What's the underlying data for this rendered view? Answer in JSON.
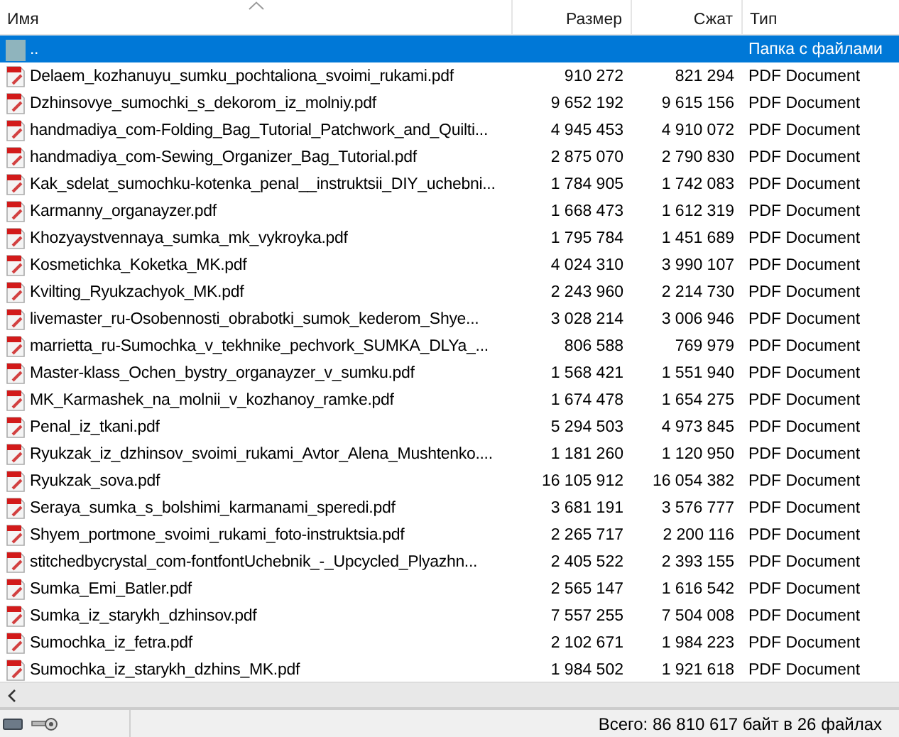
{
  "columns": [
    {
      "label": "Имя",
      "sorted": true
    },
    {
      "label": "Размер",
      "sorted": false
    },
    {
      "label": "Сжат",
      "sorted": false
    },
    {
      "label": "Тип",
      "sorted": false
    }
  ],
  "rows": [
    {
      "kind": "parent",
      "name": "..",
      "size": "",
      "packed": "",
      "type": "Папка с файлами",
      "selected": true
    },
    {
      "kind": "pdf",
      "name": "Delaem_kozhanuyu_sumku_pochtaliona_svoimi_rukami.pdf",
      "size": "910 272",
      "packed": "821 294",
      "type": "PDF Document",
      "selected": false
    },
    {
      "kind": "pdf",
      "name": "Dzhinsovye_sumochki_s_dekorom_iz_molniy.pdf",
      "size": "9 652 192",
      "packed": "9 615 156",
      "type": "PDF Document",
      "selected": false
    },
    {
      "kind": "pdf",
      "name": "handmadiya_com-Folding_Bag_Tutorial_Patchwork_and_Quilti...",
      "size": "4 945 453",
      "packed": "4 910 072",
      "type": "PDF Document",
      "selected": false
    },
    {
      "kind": "pdf",
      "name": "handmadiya_com-Sewing_Organizer_Bag_Tutorial.pdf",
      "size": "2 875 070",
      "packed": "2 790 830",
      "type": "PDF Document",
      "selected": false
    },
    {
      "kind": "pdf",
      "name": "Kak_sdelat_sumochku-kotenka_penal__instruktsii_DIY_uchebni...",
      "size": "1 784 905",
      "packed": "1 742 083",
      "type": "PDF Document",
      "selected": false
    },
    {
      "kind": "pdf",
      "name": "Karmanny_organayzer.pdf",
      "size": "1 668 473",
      "packed": "1 612 319",
      "type": "PDF Document",
      "selected": false
    },
    {
      "kind": "pdf",
      "name": "Khozyaystvennaya_sumka_mk_vykroyka.pdf",
      "size": "1 795 784",
      "packed": "1 451 689",
      "type": "PDF Document",
      "selected": false
    },
    {
      "kind": "pdf",
      "name": "Kosmetichka_Koketka_MK.pdf",
      "size": "4 024 310",
      "packed": "3 990 107",
      "type": "PDF Document",
      "selected": false
    },
    {
      "kind": "pdf",
      "name": "Kvilting_Ryukzachyok_MK.pdf",
      "size": "2 243 960",
      "packed": "2 214 730",
      "type": "PDF Document",
      "selected": false
    },
    {
      "kind": "pdf",
      "name": "livemaster_ru-Osobennosti_obrabotki_sumok_kederom_Shye...",
      "size": "3 028 214",
      "packed": "3 006 946",
      "type": "PDF Document",
      "selected": false
    },
    {
      "kind": "pdf",
      "name": "marrietta_ru-Sumochka_v_tekhnike_pechvork_SUMKA_DLYa_...",
      "size": "806 588",
      "packed": "769 979",
      "type": "PDF Document",
      "selected": false
    },
    {
      "kind": "pdf",
      "name": "Master-klass_Ochen_bystry_organayzer_v_sumku.pdf",
      "size": "1 568 421",
      "packed": "1 551 940",
      "type": "PDF Document",
      "selected": false
    },
    {
      "kind": "pdf",
      "name": "MK_Karmashek_na_molnii_v_kozhanoy_ramke.pdf",
      "size": "1 674 478",
      "packed": "1 654 275",
      "type": "PDF Document",
      "selected": false
    },
    {
      "kind": "pdf",
      "name": "Penal_iz_tkani.pdf",
      "size": "5 294 503",
      "packed": "4 973 845",
      "type": "PDF Document",
      "selected": false
    },
    {
      "kind": "pdf",
      "name": "Ryukzak_iz_dzhinsov_svoimi_rukami_Avtor_Alena_Mushtenko....",
      "size": "1 181 260",
      "packed": "1 120 950",
      "type": "PDF Document",
      "selected": false
    },
    {
      "kind": "pdf",
      "name": "Ryukzak_sova.pdf",
      "size": "16 105 912",
      "packed": "16 054 382",
      "type": "PDF Document",
      "selected": false
    },
    {
      "kind": "pdf",
      "name": "Seraya_sumka_s_bolshimi_karmanami_speredi.pdf",
      "size": "3 681 191",
      "packed": "3 576 777",
      "type": "PDF Document",
      "selected": false
    },
    {
      "kind": "pdf",
      "name": "Shyem_portmone_svoimi_rukami_foto-instruktsia.pdf",
      "size": "2 265 717",
      "packed": "2 200 116",
      "type": "PDF Document",
      "selected": false
    },
    {
      "kind": "pdf",
      "name": "stitchedbycrystal_com-fontfontUchebnik_-_Upcycled_Plyazhn...",
      "size": "2 405 522",
      "packed": "2 393 155",
      "type": "PDF Document",
      "selected": false
    },
    {
      "kind": "pdf",
      "name": "Sumka_Emi_Batler.pdf",
      "size": "2 565 147",
      "packed": "1 616 542",
      "type": "PDF Document",
      "selected": false
    },
    {
      "kind": "pdf",
      "name": "Sumka_iz_starykh_dzhinsov.pdf",
      "size": "7 557 255",
      "packed": "7 504 008",
      "type": "PDF Document",
      "selected": false
    },
    {
      "kind": "pdf",
      "name": "Sumochka_iz_fetra.pdf",
      "size": "2 102 671",
      "packed": "1 984 223",
      "type": "PDF Document",
      "selected": false
    },
    {
      "kind": "pdf",
      "name": "Sumochka_iz_starykh_dzhins_MK.pdf",
      "size": "1 984 502",
      "packed": "1 921 618",
      "type": "PDF Document",
      "selected": false
    }
  ],
  "status_bar": {
    "summary": "Всего: 86 810 617 байт в 26 файлах"
  }
}
